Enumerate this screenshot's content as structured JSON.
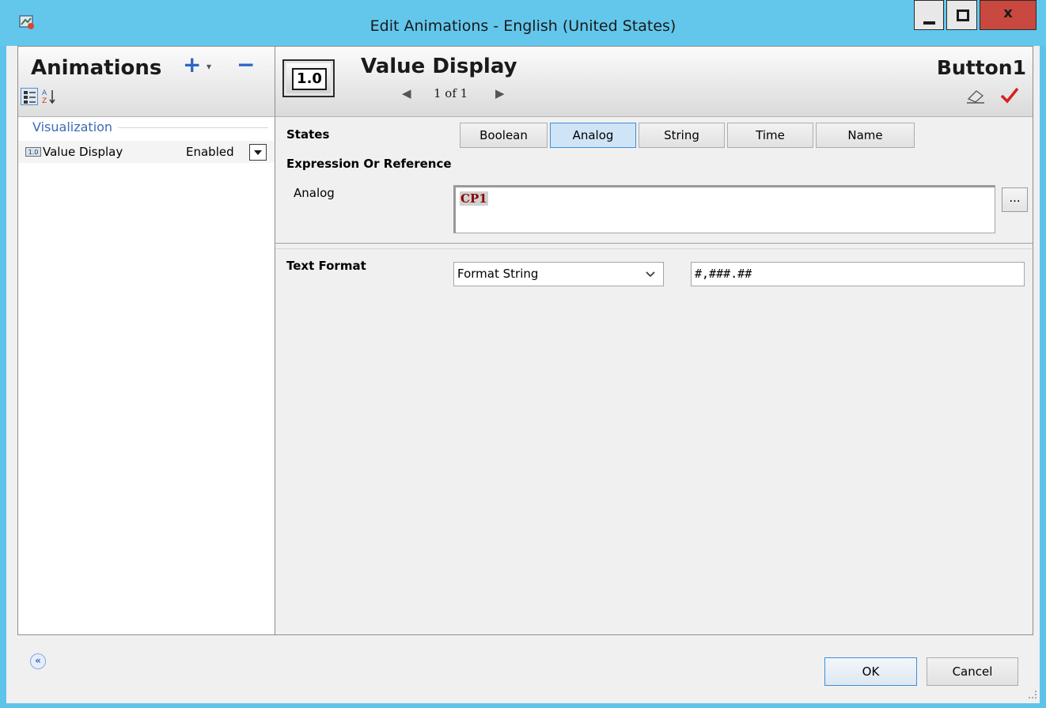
{
  "window": {
    "title": "Edit Animations - English (United States)",
    "close_glyph": "x"
  },
  "left_panel": {
    "title": "Animations",
    "add_glyph": "+",
    "add_caret_glyph": "▾",
    "remove_glyph": "−",
    "sort_glyph": "A Z↓",
    "category": "Visualization",
    "items": [
      {
        "icon_text": "1.0",
        "name": "Value Display",
        "status": "Enabled"
      }
    ]
  },
  "right_panel": {
    "icon_text": "1.0",
    "title": "Value Display",
    "prev_glyph": "◀",
    "next_glyph": "▶",
    "page_indicator": "1 of 1",
    "object_name": "Button1",
    "states_label": "States",
    "states": [
      {
        "label": "Boolean",
        "active": false
      },
      {
        "label": "Analog",
        "active": true
      },
      {
        "label": "String",
        "active": false
      },
      {
        "label": "Time",
        "active": false
      },
      {
        "label": "Name",
        "active": false
      }
    ],
    "expression_label": "Expression Or Reference",
    "expression_field_label": "Analog",
    "expression_value": "CP1",
    "browse_label": "...",
    "text_format_label": "Text Format",
    "format_select_value": "Format String",
    "format_string": "#,###.##"
  },
  "footer": {
    "collapse_glyph": "«",
    "ok_label": "OK",
    "cancel_label": "Cancel"
  },
  "icons": {
    "app": "edit-animations-icon",
    "eraser": "eraser-icon",
    "check": "check-icon"
  },
  "colors": {
    "titlebar": "#63c7ec",
    "close": "#c9483f",
    "accent": "#3e8fd6",
    "category_text": "#3b6ab8",
    "expression_text": "#8b0000",
    "check": "#d81f1f"
  }
}
